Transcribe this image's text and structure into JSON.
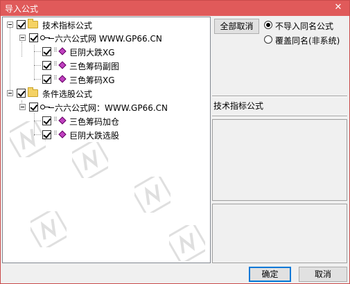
{
  "window": {
    "title": "导入公式",
    "close_glyph": "✕"
  },
  "tree": {
    "groups": [
      {
        "label": "技术指标公式",
        "source": "六六公式网 WWW.GP66.CN",
        "items": [
          "巨阴大跌XG",
          "三色筹码副图",
          "三色筹码XG"
        ]
      },
      {
        "label": "条件选股公式",
        "source": "六六公式网：WWW.GP66.CN",
        "items": [
          "三色筹码加仓",
          "巨阴大跌选股"
        ]
      }
    ]
  },
  "right": {
    "cancel_all_label": "全部取消",
    "options": [
      {
        "label": "不导入同名公式",
        "selected": true
      },
      {
        "label": "覆盖同名(非系统)",
        "selected": false
      }
    ],
    "section_label": "技术指标公式"
  },
  "footer": {
    "ok_label": "确定",
    "cancel_label": "取消"
  },
  "colors": {
    "titlebar": "#e05a5a",
    "item_icon": "#c040c0",
    "folder": "#f5d264"
  }
}
